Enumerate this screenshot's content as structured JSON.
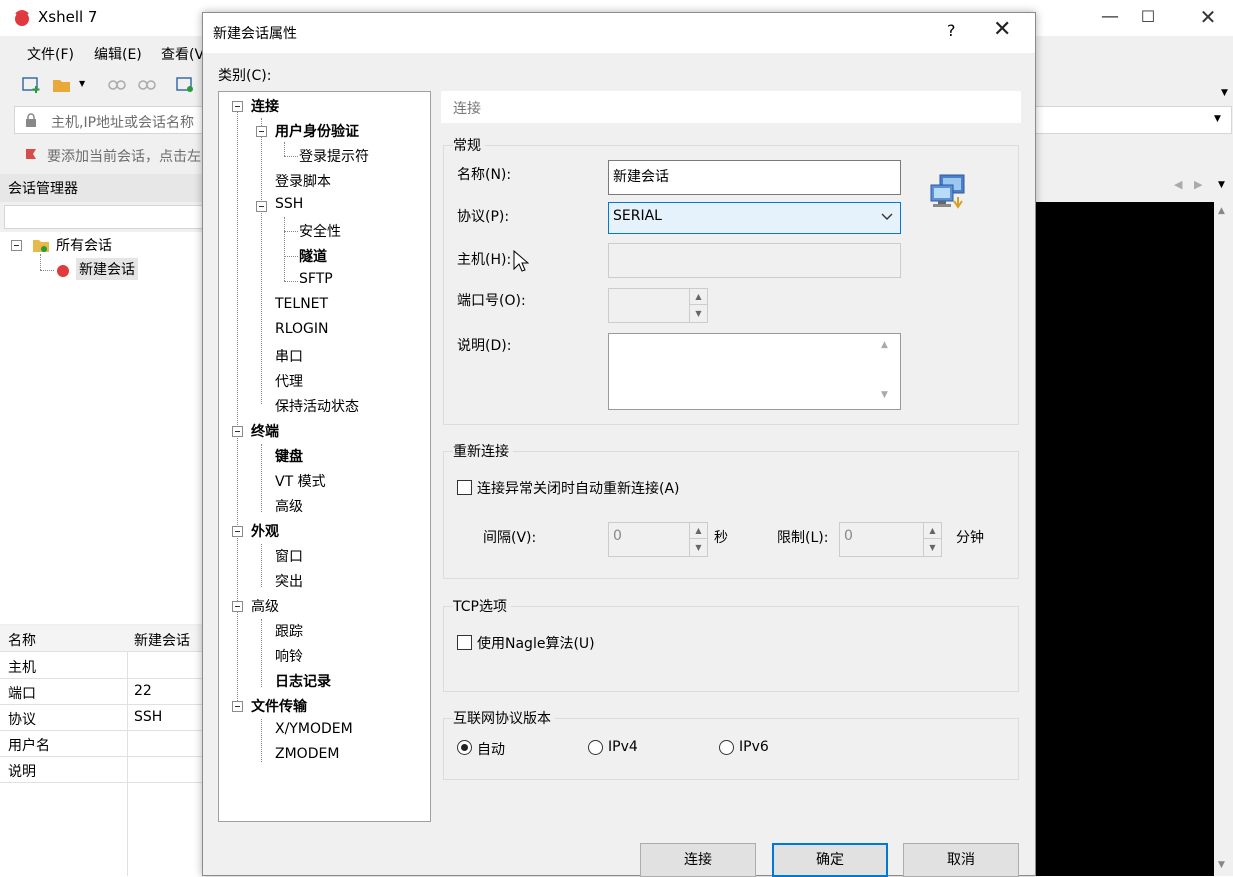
{
  "app": {
    "title": "Xshell 7",
    "menu": [
      "文件(F)",
      "编辑(E)",
      "查看(V"
    ],
    "address_placeholder": "主机,IP地址或会话名称",
    "info_text": "要添加当前会话，点击左",
    "session_manager": {
      "title": "会话管理器",
      "tree": {
        "root": "所有会话",
        "child": "新建会话"
      }
    },
    "properties": {
      "headers": [
        "名称",
        "新建会话"
      ],
      "rows": [
        {
          "key": "主机",
          "value": ""
        },
        {
          "key": "端口",
          "value": "22"
        },
        {
          "key": "协议",
          "value": "SSH"
        },
        {
          "key": "用户名",
          "value": ""
        },
        {
          "key": "说明",
          "value": ""
        }
      ]
    }
  },
  "dialog": {
    "title": "新建会话属性",
    "help": "?",
    "category_label": "类别(C):",
    "tree": [
      {
        "label": "连接",
        "bold": true
      },
      {
        "label": "用户身份验证",
        "bold": true
      },
      {
        "label": "登录提示符",
        "bold": false
      },
      {
        "label": "登录脚本",
        "bold": false
      },
      {
        "label": "SSH",
        "bold": false
      },
      {
        "label": "安全性",
        "bold": false
      },
      {
        "label": "隧道",
        "bold": true
      },
      {
        "label": "SFTP",
        "bold": false
      },
      {
        "label": "TELNET",
        "bold": false
      },
      {
        "label": "RLOGIN",
        "bold": false
      },
      {
        "label": "串口",
        "bold": false
      },
      {
        "label": "代理",
        "bold": false
      },
      {
        "label": "保持活动状态",
        "bold": false
      },
      {
        "label": "终端",
        "bold": true
      },
      {
        "label": "键盘",
        "bold": true
      },
      {
        "label": "VT 模式",
        "bold": false
      },
      {
        "label": "高级",
        "bold": false
      },
      {
        "label": "外观",
        "bold": true
      },
      {
        "label": "窗口",
        "bold": false
      },
      {
        "label": "突出",
        "bold": false
      },
      {
        "label": "高级",
        "bold": false
      },
      {
        "label": "跟踪",
        "bold": false
      },
      {
        "label": "响铃",
        "bold": false
      },
      {
        "label": "日志记录",
        "bold": true
      },
      {
        "label": "文件传输",
        "bold": true
      },
      {
        "label": "X/YMODEM",
        "bold": false
      },
      {
        "label": "ZMODEM",
        "bold": false
      }
    ],
    "section_header": "连接",
    "general": {
      "title": "常规",
      "name_label": "名称(N):",
      "name_value": "新建会话",
      "protocol_label": "协议(P):",
      "protocol_value": "SERIAL",
      "host_label": "主机(H):",
      "host_value": "",
      "port_label": "端口号(O):",
      "port_value": "",
      "desc_label": "说明(D):",
      "desc_value": ""
    },
    "reconnect": {
      "title": "重新连接",
      "checkbox_label": "连接异常关闭时自动重新连接(A)",
      "checked": false,
      "interval_label": "间隔(V):",
      "interval_value": "0",
      "interval_unit": "秒",
      "limit_label": "限制(L):",
      "limit_value": "0",
      "limit_unit": "分钟"
    },
    "tcp": {
      "title": "TCP选项",
      "nagle_label": "使用Nagle算法(U)",
      "checked": false
    },
    "ip_version": {
      "title": "互联网协议版本",
      "options": [
        "自动",
        "IPv4",
        "IPv6"
      ],
      "selected": "自动"
    },
    "buttons": {
      "connect": "连接",
      "ok": "确定",
      "cancel": "取消"
    }
  },
  "colors": {
    "accent": "#0078d7",
    "terminal_bg": "#000000",
    "logo": "#e0393e"
  }
}
